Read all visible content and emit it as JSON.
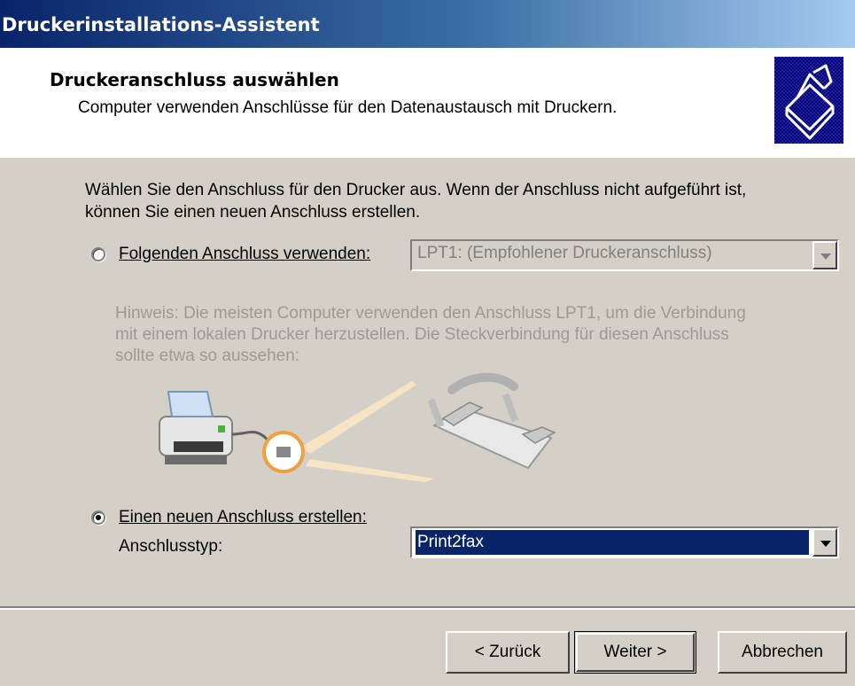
{
  "window": {
    "title": "Druckerinstallations-Assistent"
  },
  "header": {
    "title": "Druckeranschluss auswählen",
    "subtitle": "Computer verwenden Anschlüsse für den Datenaustausch mit Druckern."
  },
  "intro": "Wählen Sie den Anschluss für den Drucker aus. Wenn der Anschluss nicht aufgeführt ist, können Sie einen neuen Anschluss erstellen.",
  "existing_port": {
    "label": "Folgenden Anschluss verwenden:",
    "selected": false,
    "value": "LPT1: (Empfohlener Druckeranschluss)"
  },
  "hint": "Hinweis: Die meisten Computer verwenden den Anschluss LPT1, um die Verbindung mit einem lokalen Drucker herzustellen. Die Steckverbindung für diesen Anschluss sollte etwa so aussehen:",
  "new_port": {
    "label": "Einen neuen Anschluss erstellen:",
    "selected": true,
    "type_label": "Anschlusstyp:",
    "type_value": "Print2fax"
  },
  "buttons": {
    "back": "< Zurück",
    "next": "Weiter >",
    "cancel": "Abbrechen"
  },
  "colors": {
    "title_bar": "#0a246a",
    "selection": "#0a246a",
    "dialog": "#d4d0c8",
    "highlight_circle": "#f0a040"
  },
  "icons": [
    "printer-wizard-icon",
    "printer-icon",
    "parallel-cable-icon",
    "chevron-down-icon"
  ]
}
